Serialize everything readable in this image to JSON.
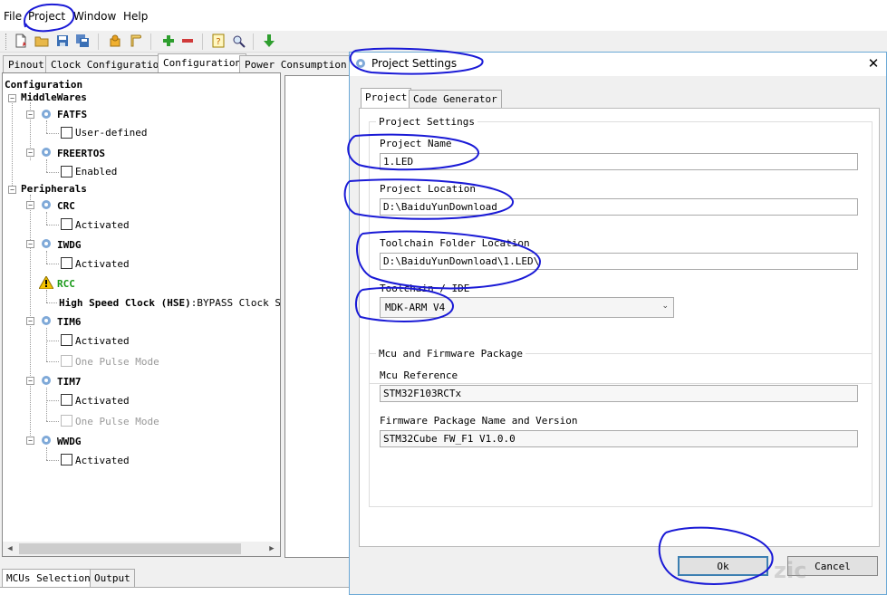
{
  "menu": [
    "File",
    "Project",
    "Window",
    "Help"
  ],
  "toolbar_icons": [
    "new-project-icon",
    "open-folder-icon",
    "save-icon",
    "save-all-icon",
    "generate-report-icon",
    "generate-code-icon",
    "add-icon",
    "remove-icon",
    "help-icon",
    "about-icon",
    "download-icon"
  ],
  "tabs": [
    "Pinout",
    "Clock Configuration",
    "Configuration",
    "Power Consumption C"
  ],
  "tree": {
    "root": "Configuration",
    "middlewares": {
      "label": "MiddleWares",
      "fatfs": {
        "label": "FATFS",
        "option": "User-defined"
      },
      "freertos": {
        "label": "FREERTOS",
        "option": "Enabled"
      }
    },
    "peripherals": {
      "label": "Peripherals",
      "crc": {
        "label": "CRC",
        "option": "Activated"
      },
      "iwdg": {
        "label": "IWDG",
        "option": "Activated"
      },
      "rcc": {
        "label": "RCC",
        "hse_label": "High Speed Clock (HSE)",
        "hse_value": ":BYPASS Clock S"
      },
      "tim6": {
        "label": "TIM6",
        "option1": "Activated",
        "option2": "One Pulse Mode"
      },
      "tim7": {
        "label": "TIM7",
        "option1": "Activated",
        "option2": "One Pulse Mode"
      },
      "wwdg": {
        "label": "WWDG",
        "option": "Activated"
      }
    }
  },
  "bottom_tabs": [
    "MCUs Selection",
    "Output"
  ],
  "dialog": {
    "title": "Project Settings",
    "tabs": [
      "Project",
      "Code Generator"
    ],
    "project_settings_group": "Project Settings",
    "project_name_label": "Project Name",
    "project_name": "1.LED",
    "project_location_label": "Project Location",
    "project_location": "D:\\BaiduYunDownload",
    "toolchain_folder_label": "Toolchain Folder Location",
    "toolchain_folder": "D:\\BaiduYunDownload\\1.LED\\",
    "toolchain_ide_label": "Toolchain / IDE",
    "toolchain_ide": "MDK-ARM V4",
    "mcu_group": "Mcu and Firmware Package",
    "mcu_reference_label": "Mcu Reference",
    "mcu_reference": "STM32F103RCTx",
    "firmware_label": "Firmware Package Name and Version",
    "firmware": "STM32Cube FW_F1 V1.0.0",
    "ok": "Ok",
    "cancel": "Cancel"
  },
  "colors": {
    "annotation": "#1a1ad6",
    "dialog_border": "#6aa8d6",
    "warning": "#f5c400",
    "rcc_green": "#1a9a1a"
  }
}
